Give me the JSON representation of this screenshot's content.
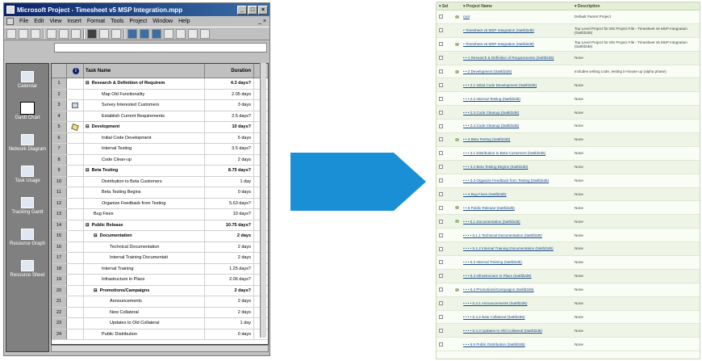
{
  "msp": {
    "title": "Microsoft Project - Timesheet v5 MSP Integration.mpp",
    "menu": [
      "File",
      "Edit",
      "View",
      "Insert",
      "Format",
      "Tools",
      "Project",
      "Window",
      "Help"
    ],
    "mdi_controls": "_ ×",
    "window_controls": [
      "_",
      "□",
      "×"
    ],
    "views": [
      "Calendar",
      "Gantt Chart",
      "Network Diagram",
      "Task Usage",
      "Tracking Gantt",
      "Resource Graph",
      "Resource Sheet"
    ],
    "columns": {
      "id": "",
      "info": "i",
      "name": "Task Name",
      "duration": "Duration"
    },
    "tasks": [
      {
        "id": "1",
        "name": "Research & Definition of Requirem",
        "duration": "4.3 days?",
        "level": 0,
        "summary": true,
        "toggle": "−",
        "icon": ""
      },
      {
        "id": "2",
        "name": "Map Old Functionality",
        "duration": "2.05 days",
        "level": 2,
        "summary": false,
        "toggle": "",
        "icon": ""
      },
      {
        "id": "3",
        "name": "Survey Interested Customers",
        "duration": "3 days",
        "level": 2,
        "summary": false,
        "toggle": "",
        "icon": "table"
      },
      {
        "id": "4",
        "name": "Establish Current Requirements",
        "duration": "2.5 days?",
        "level": 2,
        "summary": false,
        "toggle": "",
        "icon": ""
      },
      {
        "id": "5",
        "name": "Development",
        "duration": "10 days?",
        "level": 0,
        "summary": true,
        "toggle": "−",
        "icon": "note"
      },
      {
        "id": "6",
        "name": "Initial Code Development",
        "duration": "5 days",
        "level": 2,
        "summary": false,
        "toggle": "",
        "icon": ""
      },
      {
        "id": "7",
        "name": "Internal Testing",
        "duration": "3.5 days?",
        "level": 2,
        "summary": false,
        "toggle": "",
        "icon": ""
      },
      {
        "id": "8",
        "name": "Code Clean-up",
        "duration": "2 days",
        "level": 2,
        "summary": false,
        "toggle": "",
        "icon": ""
      },
      {
        "id": "9",
        "name": "Beta Testing",
        "duration": "8.75 days?",
        "level": 0,
        "summary": true,
        "toggle": "−",
        "icon": ""
      },
      {
        "id": "10",
        "name": "Distribution to Beta Customers",
        "duration": "1 day",
        "level": 2,
        "summary": false,
        "toggle": "",
        "icon": ""
      },
      {
        "id": "11",
        "name": "Beta Testing Begins",
        "duration": "0 days",
        "level": 2,
        "summary": false,
        "toggle": "",
        "icon": ""
      },
      {
        "id": "12",
        "name": "Organize Feedback from Testing",
        "duration": "5.63 days?",
        "level": 2,
        "summary": false,
        "toggle": "",
        "icon": ""
      },
      {
        "id": "13",
        "name": "Bug Fixes",
        "duration": "10 days?",
        "level": 1,
        "summary": false,
        "toggle": "",
        "icon": ""
      },
      {
        "id": "14",
        "name": "Public Release",
        "duration": "10.75 days?",
        "level": 0,
        "summary": true,
        "toggle": "−",
        "icon": ""
      },
      {
        "id": "15",
        "name": "Documentation",
        "duration": "2 days",
        "level": 1,
        "summary": true,
        "toggle": "−",
        "icon": ""
      },
      {
        "id": "16",
        "name": "Technical Documentation",
        "duration": "2 days",
        "level": 3,
        "summary": false,
        "toggle": "",
        "icon": ""
      },
      {
        "id": "17",
        "name": "Internal Training Documentati",
        "duration": "2 days",
        "level": 3,
        "summary": false,
        "toggle": "",
        "icon": ""
      },
      {
        "id": "18",
        "name": "Internal Training",
        "duration": "1.25 days?",
        "level": 2,
        "summary": false,
        "toggle": "",
        "icon": ""
      },
      {
        "id": "19",
        "name": "Infrastructure in Place",
        "duration": "2.06 days?",
        "level": 2,
        "summary": false,
        "toggle": "",
        "icon": ""
      },
      {
        "id": "20",
        "name": "Promotions/Campaigns",
        "duration": "2 days?",
        "level": 1,
        "summary": true,
        "toggle": "−",
        "icon": ""
      },
      {
        "id": "21",
        "name": "Announcements",
        "duration": "2 days",
        "level": 3,
        "summary": false,
        "toggle": "",
        "icon": ""
      },
      {
        "id": "22",
        "name": "New Collateral",
        "duration": "2 days",
        "level": 3,
        "summary": false,
        "toggle": "",
        "icon": ""
      },
      {
        "id": "23",
        "name": "Updates to Old Collateral",
        "duration": "1 day",
        "level": 3,
        "summary": false,
        "toggle": "",
        "icon": ""
      },
      {
        "id": "24",
        "name": "Public Distribution",
        "duration": "0 days",
        "level": 2,
        "summary": false,
        "toggle": "",
        "icon": ""
      }
    ]
  },
  "arrow": {
    "color": "#1b8fd6"
  },
  "sp": {
    "columns": {
      "select": "▾ Sel",
      "name": "▾ Project Name",
      "description": "▾ Description"
    },
    "rows": [
      {
        "name": "root",
        "desc": "Default Parent Project",
        "att": true
      },
      {
        "name": "• Timesheet v5 MSP Integration (0a6fd2d6)",
        "desc": "Top Level Project for MS Project File - Timesheet v5 MSP Integration (0a6fd2d6)",
        "att": false
      },
      {
        "name": "• Timesheet v5 MSP Integration (0a6fd2d6)",
        "desc": "Top Level Project for MS Project File - Timesheet v5 MSP Integration (0a6fd2d6)",
        "att": true
      },
      {
        "name": "• • 1 Research & Definition of Requirements (0a6fd2d6)",
        "desc": "None",
        "att": false
      },
      {
        "name": "• • 2 Development (0a6fd2d6)",
        "desc": "Includes writing code, testing in-house up (alpha phase)",
        "att": true
      },
      {
        "name": "• • • 2.1 Initial Code Development (0a6fd2d6)",
        "desc": "None",
        "att": false
      },
      {
        "name": "• • • 2.2 Internal Testing (0a6fd2d6)",
        "desc": "None",
        "att": false
      },
      {
        "name": "• • • 2.3 Code Cleanup (0a6fd2d6)",
        "desc": "None",
        "att": false
      },
      {
        "name": "• • • 2.4 Code Cleanup (0a6fd2d6)",
        "desc": "None",
        "att": false
      },
      {
        "name": "• • 3 Beta Testing (0a6fd2d6)",
        "desc": "None",
        "att": true
      },
      {
        "name": "• • • 3.1 Distribution to Beta Customers (0a6fd2d6)",
        "desc": "None",
        "att": false
      },
      {
        "name": "• • • 3.2 Beta Testing Begins (0a6fd2d6)",
        "desc": "None",
        "att": false
      },
      {
        "name": "• • • 3.3 Organize Feedback from Testing (0a6fd2d6)",
        "desc": "None",
        "att": false
      },
      {
        "name": "• • 4 Bug Fixes (0a6fd2d6)",
        "desc": "None",
        "att": false
      },
      {
        "name": "• • 5 Public Release (0a6fd2d6)",
        "desc": "None",
        "att": true
      },
      {
        "name": "• • • 5.1 Documentation (0a6fd2d6)",
        "desc": "None",
        "att": true
      },
      {
        "name": "• • • • 5.1.1 Technical Documentation (0a6fd2d6)",
        "desc": "None",
        "att": false
      },
      {
        "name": "• • • • 5.1.2 Internal Training Documentation (0a6fd2d6)",
        "desc": "None",
        "att": false
      },
      {
        "name": "• • • 5.2 Internal Training (0a6fd2d6)",
        "desc": "None",
        "att": false
      },
      {
        "name": "• • • 5.3 Infrastructure in Place (0a6fd2d6)",
        "desc": "None",
        "att": false
      },
      {
        "name": "• • • 5.4 Promotions/Campaigns (0a6fd2d6)",
        "desc": "None",
        "att": true
      },
      {
        "name": "• • • • 5.4.1 Announcements (0a6fd2d6)",
        "desc": "None",
        "att": false
      },
      {
        "name": "• • • • 5.4.2 New Collateral (0a6fd2d6)",
        "desc": "None",
        "att": false
      },
      {
        "name": "• • • • 5.4.3 Updates to Old Collateral (0a6fd2d6)",
        "desc": "None",
        "att": false
      },
      {
        "name": "• • • 5.5 Public Distribution (0a6fd2d6)",
        "desc": "None",
        "att": false
      }
    ]
  }
}
